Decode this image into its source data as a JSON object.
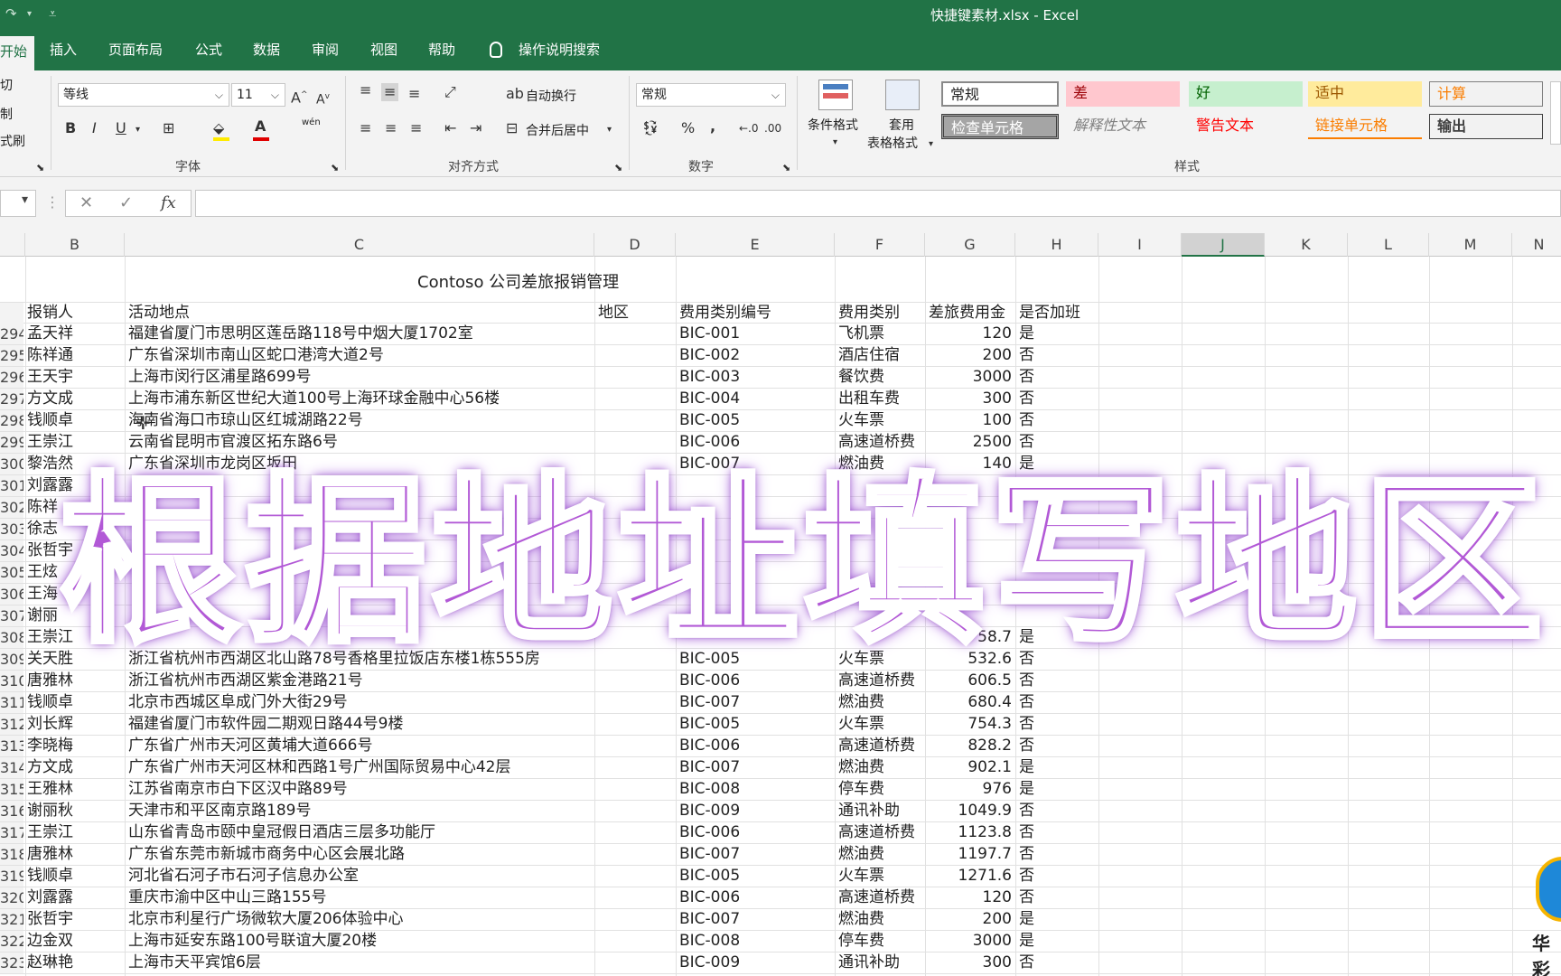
{
  "window": {
    "title": "快捷键素材.xlsx  -  Excel"
  },
  "tabs": [
    {
      "label": "开始",
      "active": true
    },
    {
      "label": "插入"
    },
    {
      "label": "页面布局"
    },
    {
      "label": "公式"
    },
    {
      "label": "数据"
    },
    {
      "label": "审阅"
    },
    {
      "label": "视图"
    },
    {
      "label": "帮助"
    }
  ],
  "tell_me": "操作说明搜索",
  "ribbon": {
    "clipboard": {
      "cut": "剪切",
      "copy": "复制",
      "format_painter": "格式刷"
    },
    "font": {
      "name": "等线",
      "size": "11",
      "group": "字体",
      "pinyin": "wén"
    },
    "align": {
      "wrap": "自动换行",
      "merge": "合并后居中",
      "group": "对齐方式"
    },
    "number": {
      "format": "常规",
      "group": "数字"
    },
    "styles": {
      "cond_format": "条件格式",
      "table_format_1": "套用",
      "table_format_2": "表格格式",
      "group": "样式",
      "cells": [
        {
          "label": "常规",
          "bg": "#ffffff",
          "fg": "#222222"
        },
        {
          "label": "差",
          "bg": "#ffc7ce",
          "fg": "#9c0006"
        },
        {
          "label": "好",
          "bg": "#c6efce",
          "fg": "#006100"
        },
        {
          "label": "适中",
          "bg": "#ffeb9c",
          "fg": "#9c5700"
        },
        {
          "label": "计算",
          "bg": "#f2f2f2",
          "fg": "#fa7d00"
        },
        {
          "label": "检查单元格",
          "bg": "#a5a5a5",
          "fg": "#ffffff"
        },
        {
          "label": "解释性文本",
          "bg": "#f3f3f3",
          "fg": "#7f7f7f"
        },
        {
          "label": "警告文本",
          "bg": "#f3f3f3",
          "fg": "#ff0000"
        },
        {
          "label": "链接单元格",
          "bg": "#f3f3f3",
          "fg": "#fa7d00"
        },
        {
          "label": "输出",
          "bg": "#f2f2f2",
          "fg": "#3f3f3f"
        }
      ]
    }
  },
  "formula_bar": {
    "cancel": "✕",
    "enter": "✓",
    "fx": "fx",
    "value": ""
  },
  "columns": [
    "B",
    "C",
    "D",
    "E",
    "F",
    "G",
    "H",
    "I",
    "J",
    "K",
    "L",
    "M",
    "N"
  ],
  "sheet_title": "Contoso 公司差旅报销管理",
  "headers": {
    "b": "报销人",
    "c": "活动地点",
    "d": "地区",
    "e": "费用类别编号",
    "f": "费用类别",
    "g": "差旅费用金",
    "h": "是否加班"
  },
  "rows": [
    {
      "rn": "294",
      "b": "孟天祥",
      "c": "福建省厦门市思明区莲岳路118号中烟大厦1702室",
      "e": "BIC-001",
      "f": "飞机票",
      "g": "120",
      "h": "是"
    },
    {
      "rn": "295",
      "b": "陈祥通",
      "c": "广东省深圳市南山区蛇口港湾大道2号",
      "e": "BIC-002",
      "f": "酒店住宿",
      "g": "200",
      "h": "否"
    },
    {
      "rn": "296",
      "b": "王天宇",
      "c": "上海市闵行区浦星路699号",
      "e": "BIC-003",
      "f": "餐饮费",
      "g": "3000",
      "h": "否"
    },
    {
      "rn": "297",
      "b": "方文成",
      "c": "上海市浦东新区世纪大道100号上海环球金融中心56楼",
      "e": "BIC-004",
      "f": "出租车费",
      "g": "300",
      "h": "否"
    },
    {
      "rn": "298",
      "b": "钱顺卓",
      "c": "海南省海口市琼山区红城湖路22号",
      "e": "BIC-005",
      "f": "火车票",
      "g": "100",
      "h": "否"
    },
    {
      "rn": "299",
      "b": "王崇江",
      "c": "云南省昆明市官渡区拓东路6号",
      "e": "BIC-006",
      "f": "高速道桥费",
      "g": "2500",
      "h": "否"
    },
    {
      "rn": "300",
      "b": "黎浩然",
      "c": "广东省深圳市龙岗区坂田",
      "e": "BIC-007",
      "f": "燃油费",
      "g": "140",
      "h": "是"
    },
    {
      "rn": "301",
      "b": "刘露露",
      "c": "",
      "e": "",
      "f": "",
      "g": "",
      "h": ""
    },
    {
      "rn": "302",
      "b": "陈祥",
      "c": "",
      "e": "",
      "f": "",
      "g": "",
      "h": ""
    },
    {
      "rn": "303",
      "b": "徐志",
      "c": "",
      "e": "",
      "f": "",
      "g": "",
      "h": ""
    },
    {
      "rn": "304",
      "b": "张哲宇",
      "c": "",
      "e": "",
      "f": "",
      "g": "",
      "h": ""
    },
    {
      "rn": "305",
      "b": "王炫",
      "c": "",
      "e": "",
      "f": "",
      "g": "",
      "h": ""
    },
    {
      "rn": "306",
      "b": "王海",
      "c": "",
      "e": "",
      "f": "",
      "g": "",
      "h": ""
    },
    {
      "rn": "307",
      "b": "谢丽",
      "c": "",
      "e": "",
      "f": "",
      "g": "",
      "h": ""
    },
    {
      "rn": "308",
      "b": "王崇江",
      "c": "",
      "e": "",
      "f": "",
      "g": "58.7",
      "h": "是"
    },
    {
      "rn": "309",
      "b": "关天胜",
      "c": "浙江省杭州市西湖区北山路78号香格里拉饭店东楼1栋555房",
      "e": "BIC-005",
      "f": "火车票",
      "g": "532.6",
      "h": "否"
    },
    {
      "rn": "310",
      "b": "唐雅林",
      "c": "浙江省杭州市西湖区紫金港路21号",
      "e": "BIC-006",
      "f": "高速道桥费",
      "g": "606.5",
      "h": "否"
    },
    {
      "rn": "311",
      "b": "钱顺卓",
      "c": "北京市西城区阜成门外大街29号",
      "e": "BIC-007",
      "f": "燃油费",
      "g": "680.4",
      "h": "否"
    },
    {
      "rn": "312",
      "b": "刘长辉",
      "c": "福建省厦门市软件园二期观日路44号9楼",
      "e": "BIC-005",
      "f": "火车票",
      "g": "754.3",
      "h": "否"
    },
    {
      "rn": "313",
      "b": "李晓梅",
      "c": "广东省广州市天河区黄埔大道666号",
      "e": "BIC-006",
      "f": "高速道桥费",
      "g": "828.2",
      "h": "否"
    },
    {
      "rn": "314",
      "b": "方文成",
      "c": "广东省广州市天河区林和西路1号广州国际贸易中心42层",
      "e": "BIC-007",
      "f": "燃油费",
      "g": "902.1",
      "h": "是"
    },
    {
      "rn": "315",
      "b": "王雅林",
      "c": "江苏省南京市白下区汉中路89号",
      "e": "BIC-008",
      "f": "停车费",
      "g": "976",
      "h": "是"
    },
    {
      "rn": "316",
      "b": "谢丽秋",
      "c": "天津市和平区南京路189号",
      "e": "BIC-009",
      "f": "通讯补助",
      "g": "1049.9",
      "h": "否"
    },
    {
      "rn": "317",
      "b": "王崇江",
      "c": "山东省青岛市颐中皇冠假日酒店三层多功能厅",
      "e": "BIC-006",
      "f": "高速道桥费",
      "g": "1123.8",
      "h": "否"
    },
    {
      "rn": "318",
      "b": "唐雅林",
      "c": "广东省东莞市新城市商务中心区会展北路",
      "e": "BIC-007",
      "f": "燃油费",
      "g": "1197.7",
      "h": "否"
    },
    {
      "rn": "319",
      "b": "钱顺卓",
      "c": "河北省石河子市石河子信息办公室",
      "e": "BIC-005",
      "f": "火车票",
      "g": "1271.6",
      "h": "否"
    },
    {
      "rn": "320",
      "b": "刘露露",
      "c": "重庆市渝中区中山三路155号",
      "e": "BIC-006",
      "f": "高速道桥费",
      "g": "120",
      "h": "否"
    },
    {
      "rn": "321",
      "b": "张哲宇",
      "c": "北京市利星行广场微软大厦206体验中心",
      "e": "BIC-007",
      "f": "燃油费",
      "g": "200",
      "h": "是"
    },
    {
      "rn": "322",
      "b": "边金双",
      "c": "上海市延安东路100号联谊大厦20楼",
      "e": "BIC-008",
      "f": "停车费",
      "g": "3000",
      "h": "是"
    },
    {
      "rn": "323",
      "b": "赵琳艳",
      "c": "上海市天平宾馆6层",
      "e": "BIC-009",
      "f": "通讯补助",
      "g": "300",
      "h": "否"
    }
  ],
  "overlay": {
    "caption": "根据地址填写地区"
  },
  "watermark": {
    "text": "华彩"
  }
}
